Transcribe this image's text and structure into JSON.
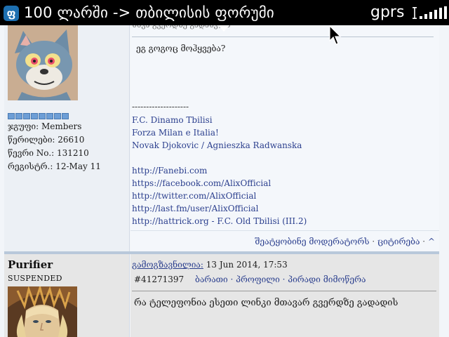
{
  "status_bar": {
    "app_icon_glyph": "ფ",
    "title": "100 ლარში -> თბილისის ფორუმი",
    "network": "gprs"
  },
  "post1": {
    "header_partial": "სხვა გვერდზე გადასვლა",
    "meta": {
      "group": "ჯგუფი: Members",
      "posts": "წერილები: 26610",
      "member_no": "წევრი No.: 131210",
      "registered": "რეგისტრ.: 12-May 11"
    },
    "message": "ეგ გოგოც მოჰყვება?",
    "signature": {
      "divider": "--------------------",
      "lines": [
        "F.C. Dinamo Tbilisi",
        "Forza Milan e Italia!",
        "Novak Djokovic / Agnieszka Radwanska"
      ],
      "links": [
        "http://Fanebi.com",
        "https://facebook.com/AlixOfficial",
        "http://twitter.com/AlixOfficial",
        "http://last.fm/user/AlixOfficial",
        "http://hattrick.org - F.C. Old Tbilisi (III.2)"
      ]
    },
    "footer": {
      "report": "შეატყობინე მოდერატორს",
      "quote": "ციტირება",
      "sep": "·",
      "top": "^"
    }
  },
  "post2": {
    "username": "Purifier",
    "status": "SUSPENDED",
    "posted_label": "გამოგზავნილია:",
    "posted_date": "13 Jun 2014, 17:53",
    "post_id": "#41271397",
    "actions": "ბარათი · პროფილი · პირადი მიმოწერა",
    "message": "რა ტელეფონია ესეთი ლინკი მთავარ გვერდზე გადადის"
  }
}
